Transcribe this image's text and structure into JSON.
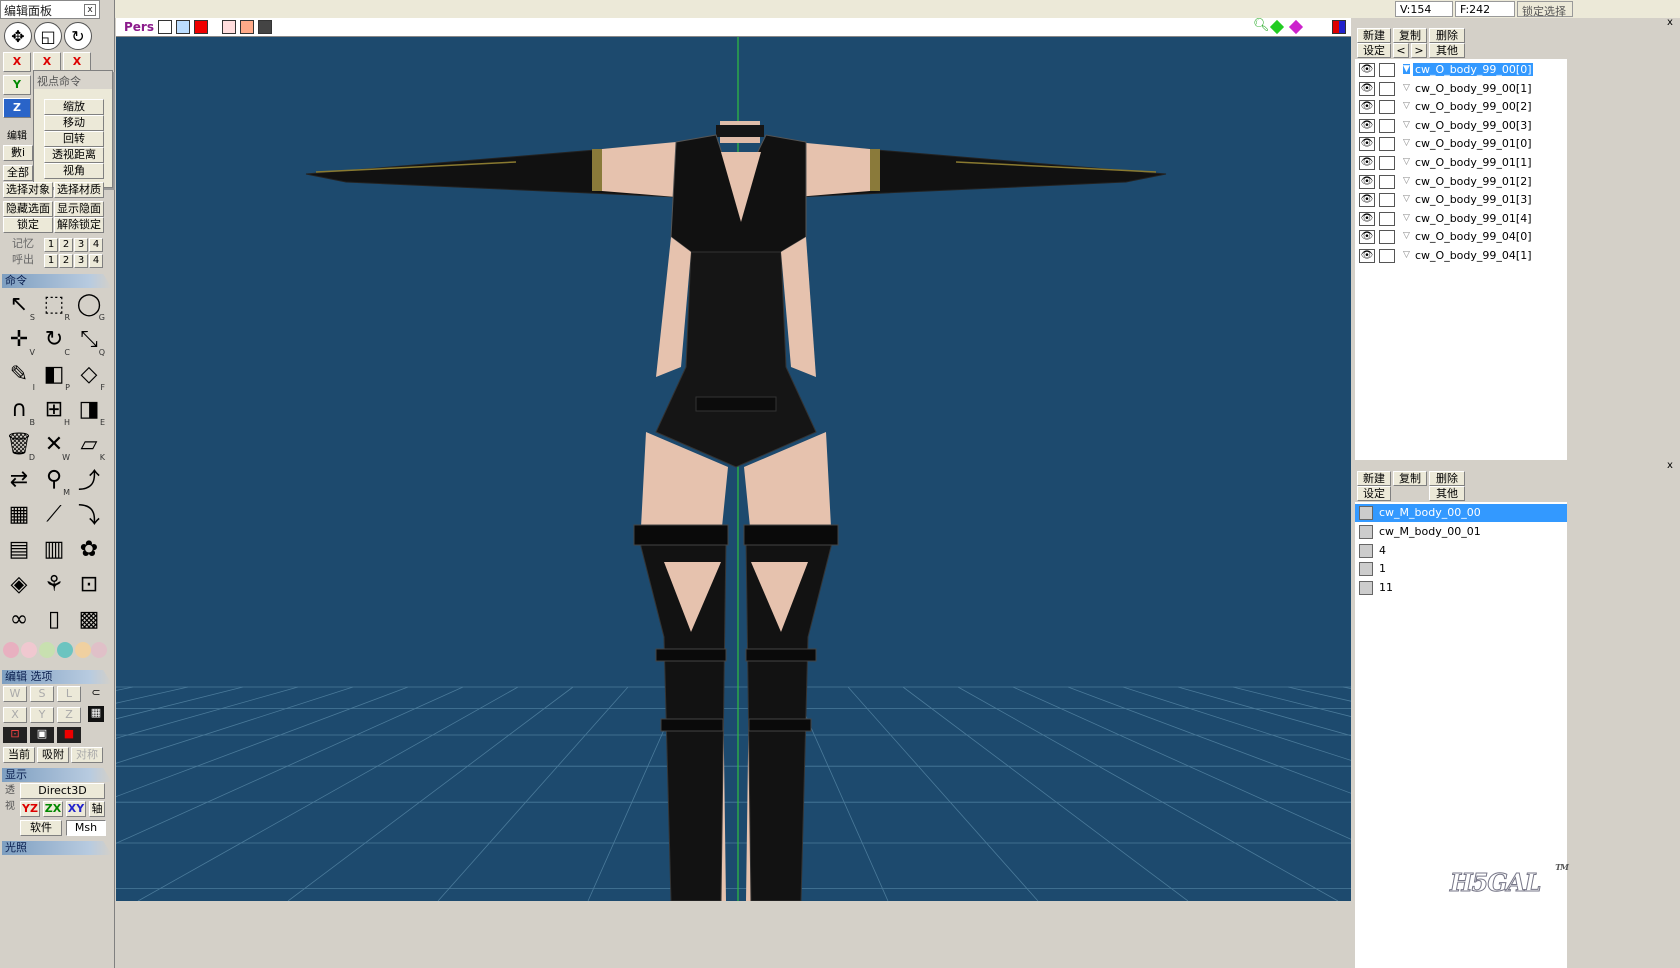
{
  "left_panel": {
    "title": "编辑面板",
    "close_label": "x",
    "axes": {
      "x": "X",
      "y": "Y",
      "z": "Z"
    },
    "popup": {
      "title": "视点命令",
      "items": [
        "缩放",
        "移动",
        "回转",
        "透视距离",
        "视角"
      ]
    },
    "edit_section_label": "编辑",
    "edit_buttons": {
      "partial_1": "數i",
      "partial_2": "全部",
      "select_object": "选择对象",
      "select_material": "选择材质",
      "hide_selected": "隐藏选面",
      "show_hidden": "显示隐面",
      "lock": "锁定",
      "unlock": "解除锁定"
    },
    "memory": {
      "save_label": "记忆",
      "recall_label": "呼出",
      "slots": [
        "1",
        "2",
        "3",
        "4"
      ]
    },
    "command_section": "命令",
    "tools": [
      {
        "icon": "select-arrow-icon",
        "key": "S"
      },
      {
        "icon": "rect-select-icon",
        "key": "R"
      },
      {
        "icon": "lasso-icon",
        "key": "G"
      },
      {
        "icon": "move-icon",
        "key": "V"
      },
      {
        "icon": "rotate-icon",
        "key": "C"
      },
      {
        "icon": "scale-icon",
        "key": "Q"
      },
      {
        "icon": "create-icon",
        "key": "I"
      },
      {
        "icon": "primitive-icon",
        "key": "P"
      },
      {
        "icon": "face-icon",
        "key": "F"
      },
      {
        "icon": "magnet-icon",
        "key": "B"
      },
      {
        "icon": "knife-icon",
        "key": "H"
      },
      {
        "icon": "extrude-icon",
        "key": "E"
      },
      {
        "icon": "delete-icon",
        "key": "D"
      },
      {
        "icon": "weld-icon",
        "key": "W"
      },
      {
        "icon": "bevel-icon",
        "key": "K"
      },
      {
        "icon": "mirror-icon",
        "key": ""
      },
      {
        "icon": "paint-icon",
        "key": "M"
      },
      {
        "icon": "bend-icon",
        "key": ""
      },
      {
        "icon": "lattice-icon",
        "key": ""
      },
      {
        "icon": "skin-icon",
        "key": ""
      },
      {
        "icon": "bone-icon",
        "key": ""
      },
      {
        "icon": "uv-icon",
        "key": ""
      },
      {
        "icon": "vertex-color-icon",
        "key": ""
      },
      {
        "icon": "palette-icon",
        "key": ""
      },
      {
        "icon": "morph-icon",
        "key": ""
      },
      {
        "icon": "joint-icon",
        "key": ""
      },
      {
        "icon": "point-edit-icon",
        "key": ""
      },
      {
        "icon": "link-icon",
        "key": ""
      },
      {
        "icon": "script-icon",
        "key": ""
      },
      {
        "icon": "film-icon",
        "key": ""
      }
    ],
    "edit_options_section": "编辑 选项",
    "options_row1": [
      "W",
      "S",
      "L"
    ],
    "options_row2": [
      "X",
      "Y",
      "Z"
    ],
    "snap_buttons": {
      "current": "当前",
      "snap": "吸附",
      "symmetric": "对称"
    },
    "display_section": "显示",
    "render_mode": "Direct3D",
    "view_axes": {
      "yz": "YZ",
      "zx": "ZX",
      "xy": "XY",
      "axis": "轴"
    },
    "software_label": "软件",
    "msh_label": "Msh",
    "light_section": "光照",
    "side_label_a": "透",
    "side_label_b": "视"
  },
  "top_bar": {
    "vertex_count": "V:154",
    "face_count": "F:242",
    "lock_select": "锁定选择"
  },
  "viewport": {
    "mode_label": "Pers",
    "background_color": "#1d4a6e",
    "grid_color": "#4a7a9a",
    "axis_color": "#2fbf3f"
  },
  "objects_panel": {
    "buttons": {
      "new": "新建",
      "copy": "复制",
      "delete": "删除",
      "settings": "设定",
      "prev": "<",
      "next": ">",
      "other": "其他"
    },
    "items": [
      {
        "name": "cw_O_body_99_00[0]",
        "selected": true
      },
      {
        "name": "cw_O_body_99_00[1]",
        "selected": false
      },
      {
        "name": "cw_O_body_99_00[2]",
        "selected": false
      },
      {
        "name": "cw_O_body_99_00[3]",
        "selected": false
      },
      {
        "name": "cw_O_body_99_01[0]",
        "selected": false
      },
      {
        "name": "cw_O_body_99_01[1]",
        "selected": false
      },
      {
        "name": "cw_O_body_99_01[2]",
        "selected": false
      },
      {
        "name": "cw_O_body_99_01[3]",
        "selected": false
      },
      {
        "name": "cw_O_body_99_01[4]",
        "selected": false
      },
      {
        "name": "cw_O_body_99_04[0]",
        "selected": false
      },
      {
        "name": "cw_O_body_99_04[1]",
        "selected": false
      }
    ]
  },
  "materials_panel": {
    "buttons": {
      "new": "新建",
      "copy": "复制",
      "delete": "删除",
      "settings": "设定",
      "other": "其他"
    },
    "items": [
      {
        "name": "cw_M_body_00_00",
        "selected": true
      },
      {
        "name": "cw_M_body_00_01",
        "selected": false
      },
      {
        "name": "4",
        "selected": false
      },
      {
        "name": "1",
        "selected": false
      },
      {
        "name": "11",
        "selected": false
      }
    ]
  },
  "watermark": {
    "text": "H5GAL",
    "tm": "TM"
  }
}
